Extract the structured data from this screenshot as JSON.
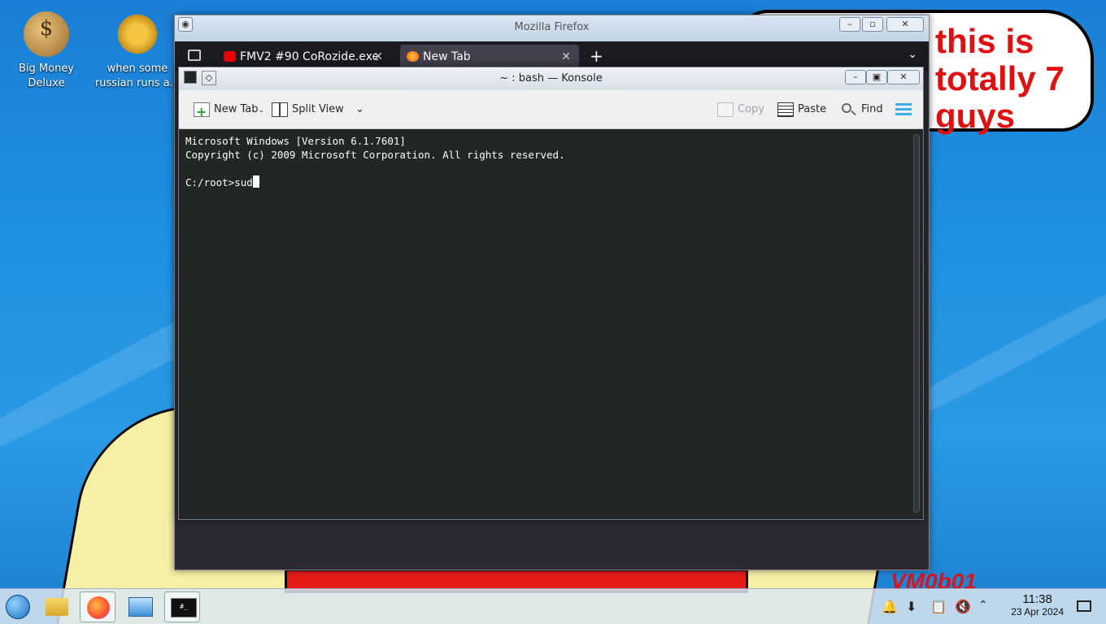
{
  "desktop": {
    "icons": [
      {
        "label": "Big Money Deluxe"
      },
      {
        "label": "when some russian runs a..."
      }
    ],
    "meme_text": "this is totally 7 guys",
    "corner_text": "VM0b01"
  },
  "firefox": {
    "title": "Mozilla Firefox",
    "tabs": [
      {
        "label": "FMV2 #90 CoRozide.exe"
      },
      {
        "label": "New Tab"
      }
    ]
  },
  "konsole": {
    "title": "~ : bash — Konsole",
    "toolbar": {
      "new_tab": "New Tab",
      "split_view": "Split View",
      "copy": "Copy",
      "paste": "Paste",
      "find": "Find"
    },
    "terminal": {
      "line1": "Microsoft Windows [Version 6.1.7601]",
      "line2": "Copyright (c) 2009 Microsoft Corporation. All rights reserved.",
      "prompt": "C:/root>sud"
    }
  },
  "taskbar": {
    "time": "11:38",
    "date": "23 Apr 2024"
  },
  "colors": {
    "terminal_bg": "#232627",
    "accent_blue": "#3daee9",
    "meme_red": "#e01010"
  }
}
